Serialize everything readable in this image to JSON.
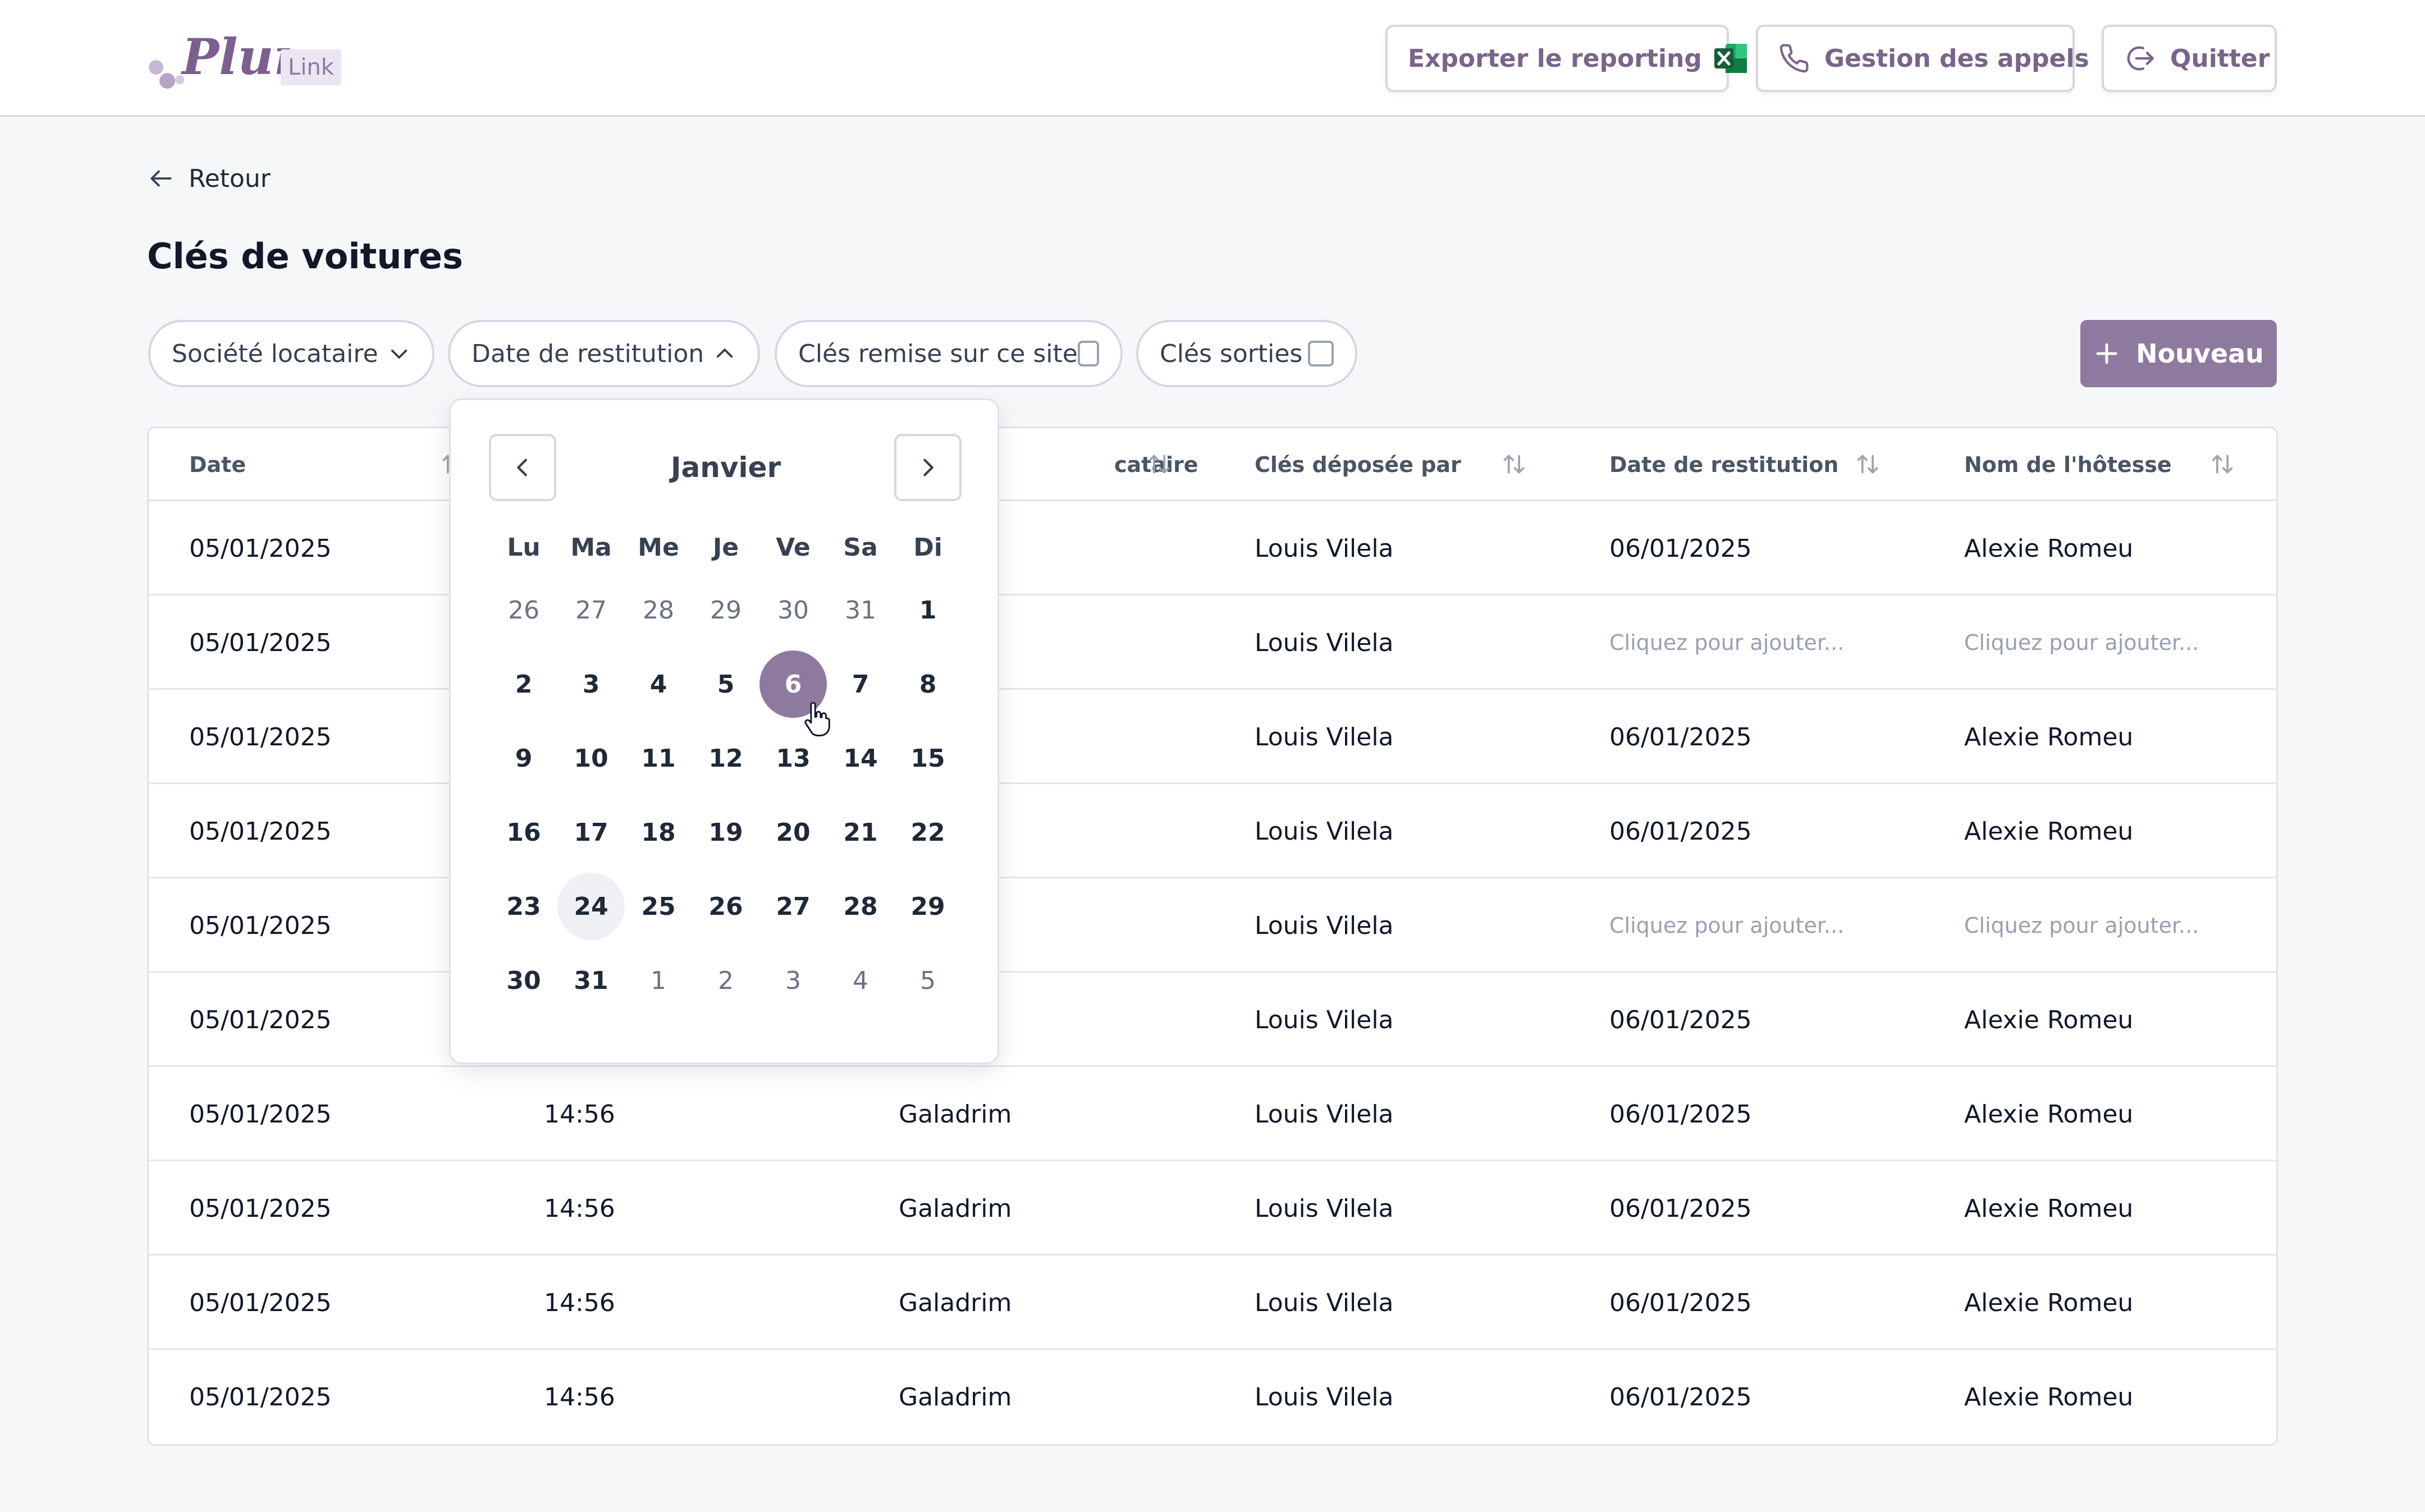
{
  "header": {
    "logo_text": "Pluri'",
    "logo_badge": "Link",
    "export_label": "Exporter le reporting",
    "calls_label": "Gestion des appels",
    "quit_label": "Quitter"
  },
  "nav": {
    "back_label": "Retour"
  },
  "page": {
    "title": "Clés de voitures"
  },
  "filters": {
    "company": "Société locataire",
    "return_date": "Date de restitution",
    "keys_on_site": "Clés remise sur ce site",
    "keys_out": "Clés sorties",
    "new_button": "Nouveau"
  },
  "table": {
    "columns": [
      "Date",
      "",
      "",
      "Clés déposée par",
      "Date de restitution",
      "Nom de l'hôtesse"
    ],
    "partial_column_text": "cataire",
    "rows": [
      [
        "05/01/2025",
        "",
        "n",
        "Louis Vilela",
        "06/01/2025",
        "Alexie Romeu"
      ],
      [
        "05/01/2025",
        "",
        "n",
        "Louis Vilela",
        "Cliquez pour ajouter...",
        "Cliquez pour ajouter..."
      ],
      [
        "05/01/2025",
        "",
        "n",
        "Louis Vilela",
        "06/01/2025",
        "Alexie Romeu"
      ],
      [
        "05/01/2025",
        "",
        "n",
        "Louis Vilela",
        "06/01/2025",
        "Alexie Romeu"
      ],
      [
        "05/01/2025",
        "",
        "n",
        "Louis Vilela",
        "Cliquez pour ajouter...",
        "Cliquez pour ajouter..."
      ],
      [
        "05/01/2025",
        "",
        "n",
        "Louis Vilela",
        "06/01/2025",
        "Alexie Romeu"
      ],
      [
        "05/01/2025",
        "14:56",
        "Galadrim",
        "Louis Vilela",
        "06/01/2025",
        "Alexie Romeu"
      ],
      [
        "05/01/2025",
        "14:56",
        "Galadrim",
        "Louis Vilela",
        "06/01/2025",
        "Alexie Romeu"
      ],
      [
        "05/01/2025",
        "14:56",
        "Galadrim",
        "Louis Vilela",
        "06/01/2025",
        "Alexie Romeu"
      ],
      [
        "05/01/2025",
        "14:56",
        "Galadrim",
        "Louis Vilela",
        "06/01/2025",
        "Alexie Romeu"
      ]
    ]
  },
  "calendar": {
    "month": "Janvier",
    "weekdays": [
      "Lu",
      "Ma",
      "Me",
      "Je",
      "Ve",
      "Sa",
      "Di"
    ],
    "days": [
      {
        "d": "26",
        "t": "other"
      },
      {
        "d": "27",
        "t": "other"
      },
      {
        "d": "28",
        "t": "other"
      },
      {
        "d": "29",
        "t": "other"
      },
      {
        "d": "30",
        "t": "other"
      },
      {
        "d": "31",
        "t": "other"
      },
      {
        "d": "1",
        "t": ""
      },
      {
        "d": "2",
        "t": ""
      },
      {
        "d": "3",
        "t": ""
      },
      {
        "d": "4",
        "t": ""
      },
      {
        "d": "5",
        "t": ""
      },
      {
        "d": "6",
        "t": "selected"
      },
      {
        "d": "7",
        "t": ""
      },
      {
        "d": "8",
        "t": ""
      },
      {
        "d": "9",
        "t": ""
      },
      {
        "d": "10",
        "t": ""
      },
      {
        "d": "11",
        "t": ""
      },
      {
        "d": "12",
        "t": ""
      },
      {
        "d": "13",
        "t": ""
      },
      {
        "d": "14",
        "t": ""
      },
      {
        "d": "15",
        "t": ""
      },
      {
        "d": "16",
        "t": ""
      },
      {
        "d": "17",
        "t": ""
      },
      {
        "d": "18",
        "t": ""
      },
      {
        "d": "19",
        "t": ""
      },
      {
        "d": "20",
        "t": ""
      },
      {
        "d": "21",
        "t": ""
      },
      {
        "d": "22",
        "t": ""
      },
      {
        "d": "23",
        "t": ""
      },
      {
        "d": "24",
        "t": "today"
      },
      {
        "d": "25",
        "t": ""
      },
      {
        "d": "26",
        "t": ""
      },
      {
        "d": "27",
        "t": ""
      },
      {
        "d": "28",
        "t": ""
      },
      {
        "d": "29",
        "t": ""
      },
      {
        "d": "30",
        "t": ""
      },
      {
        "d": "31",
        "t": ""
      },
      {
        "d": "1",
        "t": "other"
      },
      {
        "d": "2",
        "t": "other"
      },
      {
        "d": "3",
        "t": "other"
      },
      {
        "d": "4",
        "t": "other"
      },
      {
        "d": "5",
        "t": "other"
      }
    ]
  },
  "colors": {
    "accent": "#8f7a9f",
    "excel_green": "#1d7a45",
    "border": "#d8d6e3"
  },
  "icons": [
    "excel-icon",
    "phone-icon",
    "logout-icon",
    "arrow-left-icon",
    "chevron-down-icon",
    "chevron-up-icon",
    "plus-icon",
    "sort-icon",
    "chevron-left-icon",
    "chevron-right-icon",
    "pointer-cursor-icon"
  ]
}
